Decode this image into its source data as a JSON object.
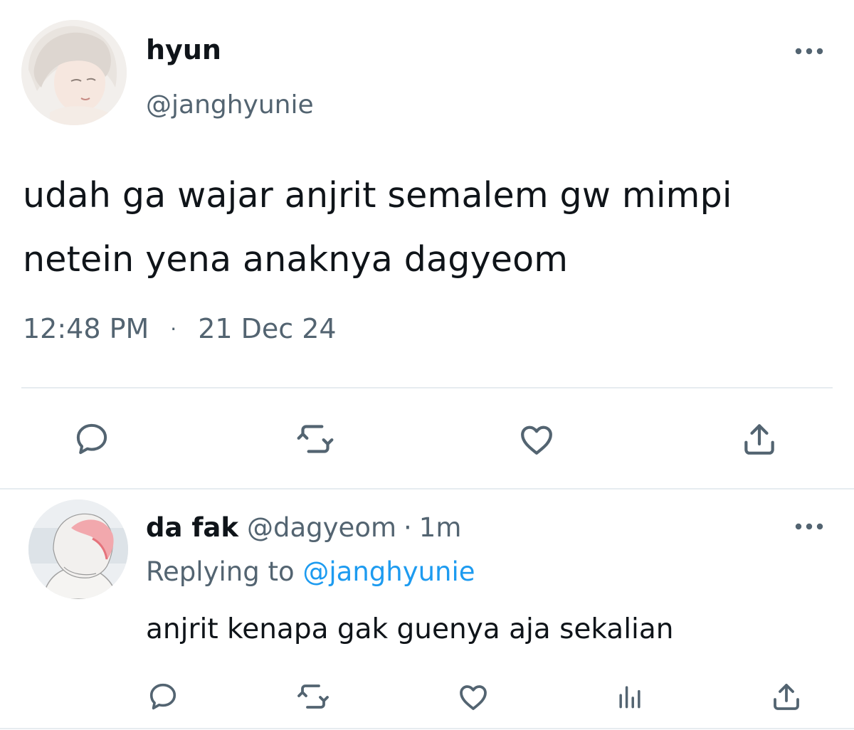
{
  "tweet": {
    "author": {
      "display_name": "hyun",
      "handle": "@janghyunie"
    },
    "text": "udah ga wajar anjrit semalem gw mimpi netein yena anaknya dagyeom",
    "time": "12:48 PM",
    "separator": "·",
    "date": "21 Dec 24",
    "more_icon": "more-horizontal-icon",
    "actions": [
      {
        "icon": "reply-icon"
      },
      {
        "icon": "retweet-icon"
      },
      {
        "icon": "like-icon"
      },
      {
        "icon": "share-icon"
      }
    ]
  },
  "reply": {
    "author": {
      "display_name": "da fak",
      "handle": "@dagyeom"
    },
    "separator": "·",
    "time_ago": "1m",
    "replying_prefix": "Replying to",
    "replying_handle": "@janghyunie",
    "text": "anjrit kenapa gak guenya aja sekalian",
    "more_icon": "more-horizontal-icon",
    "actions": [
      {
        "icon": "reply-icon"
      },
      {
        "icon": "retweet-icon"
      },
      {
        "icon": "like-icon"
      },
      {
        "icon": "analytics-icon"
      },
      {
        "icon": "share-icon"
      }
    ]
  },
  "colors": {
    "text_primary": "#0f1419",
    "text_secondary": "#536471",
    "link": "#1d9bf0",
    "divider": "#e6ecf0"
  }
}
